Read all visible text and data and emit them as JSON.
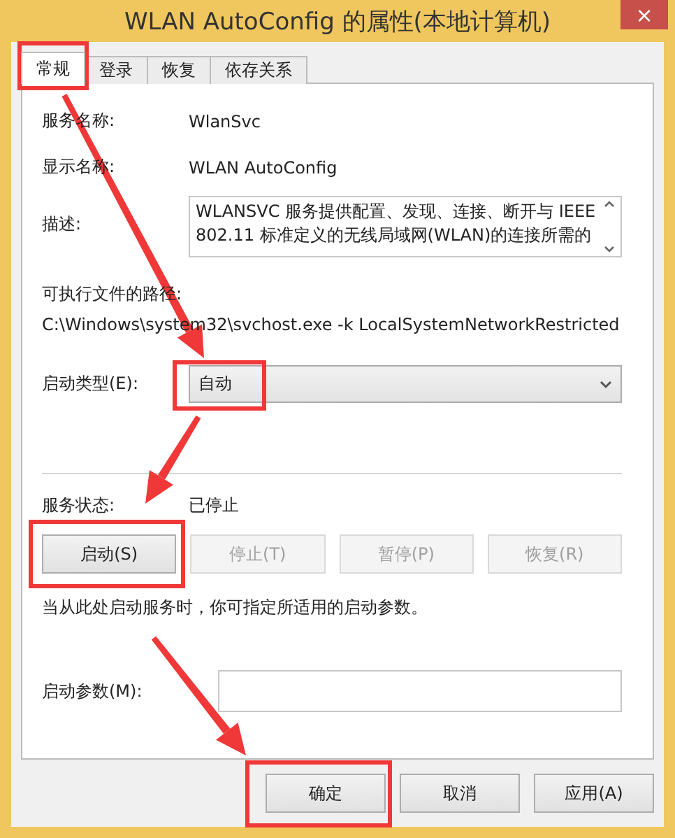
{
  "window": {
    "title": "WLAN AutoConfig 的属性(本地计算机)",
    "close": "×"
  },
  "tabs": [
    {
      "label": "常规",
      "selected": true
    },
    {
      "label": "登录",
      "selected": false
    },
    {
      "label": "恢复",
      "selected": false
    },
    {
      "label": "依存关系",
      "selected": false
    }
  ],
  "service_name": {
    "label": "服务名称:",
    "value": "WlanSvc"
  },
  "display_name": {
    "label": "显示名称:",
    "value": "WLAN AutoConfig"
  },
  "description": {
    "label": "描述:",
    "value": "WLANSVC 服务提供配置、发现、连接、断开与 IEEE 802.11 标准定义的无线局域网(WLAN)的连接所需的"
  },
  "executable_path": {
    "label": "可执行文件的路径:",
    "value": "C:\\Windows\\system32\\svchost.exe -k LocalSystemNetworkRestricted"
  },
  "startup_type": {
    "label": "启动类型(E):",
    "value": "自动"
  },
  "service_status": {
    "label": "服务状态:",
    "value": "已停止"
  },
  "service_buttons": [
    {
      "label": "启动(S)",
      "disabled": false
    },
    {
      "label": "停止(T)",
      "disabled": true
    },
    {
      "label": "暂停(P)",
      "disabled": true
    },
    {
      "label": "恢复(R)",
      "disabled": true
    }
  ],
  "hint": "当从此处启动服务时，你可指定所适用的启动参数。",
  "start_parameters": {
    "label": "启动参数(M):"
  },
  "dialog_buttons": [
    {
      "label": "确定",
      "disabled": false
    },
    {
      "label": "取消",
      "disabled": false
    },
    {
      "label": "应用(A)",
      "disabled": false
    }
  ]
}
